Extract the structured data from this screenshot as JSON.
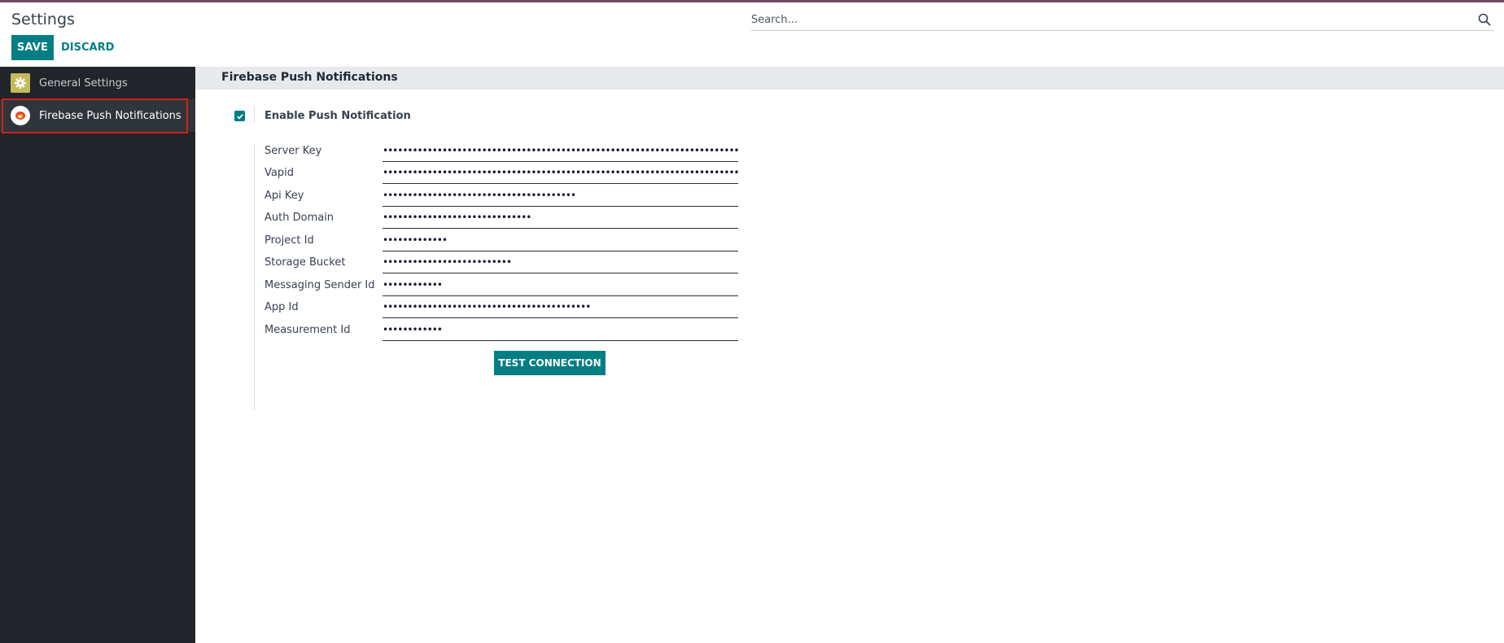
{
  "header": {
    "title": "Settings",
    "save_label": "SAVE",
    "discard_label": "DISCARD",
    "search_placeholder": "Search..."
  },
  "sidebar": {
    "items": [
      {
        "label": "General Settings",
        "icon": "gear-icon",
        "active": false
      },
      {
        "label": "Firebase Push Notifications",
        "icon": "firebase-icon",
        "active": true
      }
    ]
  },
  "section": {
    "title": "Firebase Push Notifications",
    "enable_label": "Enable Push Notification",
    "enable_checked": true,
    "fields": [
      {
        "label": "Server Key",
        "value": "•••••••••••••••••••••••••••••••••••••••••••••••••••••••••••••••••••••••••••••••••••••••••••••••••••••••••••••••••••••••••••••••"
      },
      {
        "label": "Vapid",
        "value": "•••••••••••••••••••••••••••••••••••••••••••••••••••••••••••••••••••••••••••••••••••••••••"
      },
      {
        "label": "Api Key",
        "value": "•••••••••••••••••••••••••••••••••••••••"
      },
      {
        "label": "Auth Domain",
        "value": "••••••••••••••••••••••••••••••"
      },
      {
        "label": "Project Id",
        "value": "•••••••••••••"
      },
      {
        "label": "Storage Bucket",
        "value": "••••••••••••••••••••••••••"
      },
      {
        "label": "Messaging Sender Id",
        "value": "••••••••••••"
      },
      {
        "label": "App Id",
        "value": "••••••••••••••••••••••••••••••••••••••••••"
      },
      {
        "label": "Measurement Id",
        "value": "••••••••••••"
      }
    ],
    "test_label": "TEST CONNECTION"
  },
  "colors": {
    "accent": "#017e84",
    "brand": "#714B67",
    "sidebar_bg": "#212529",
    "highlight": "#d21f1f"
  }
}
